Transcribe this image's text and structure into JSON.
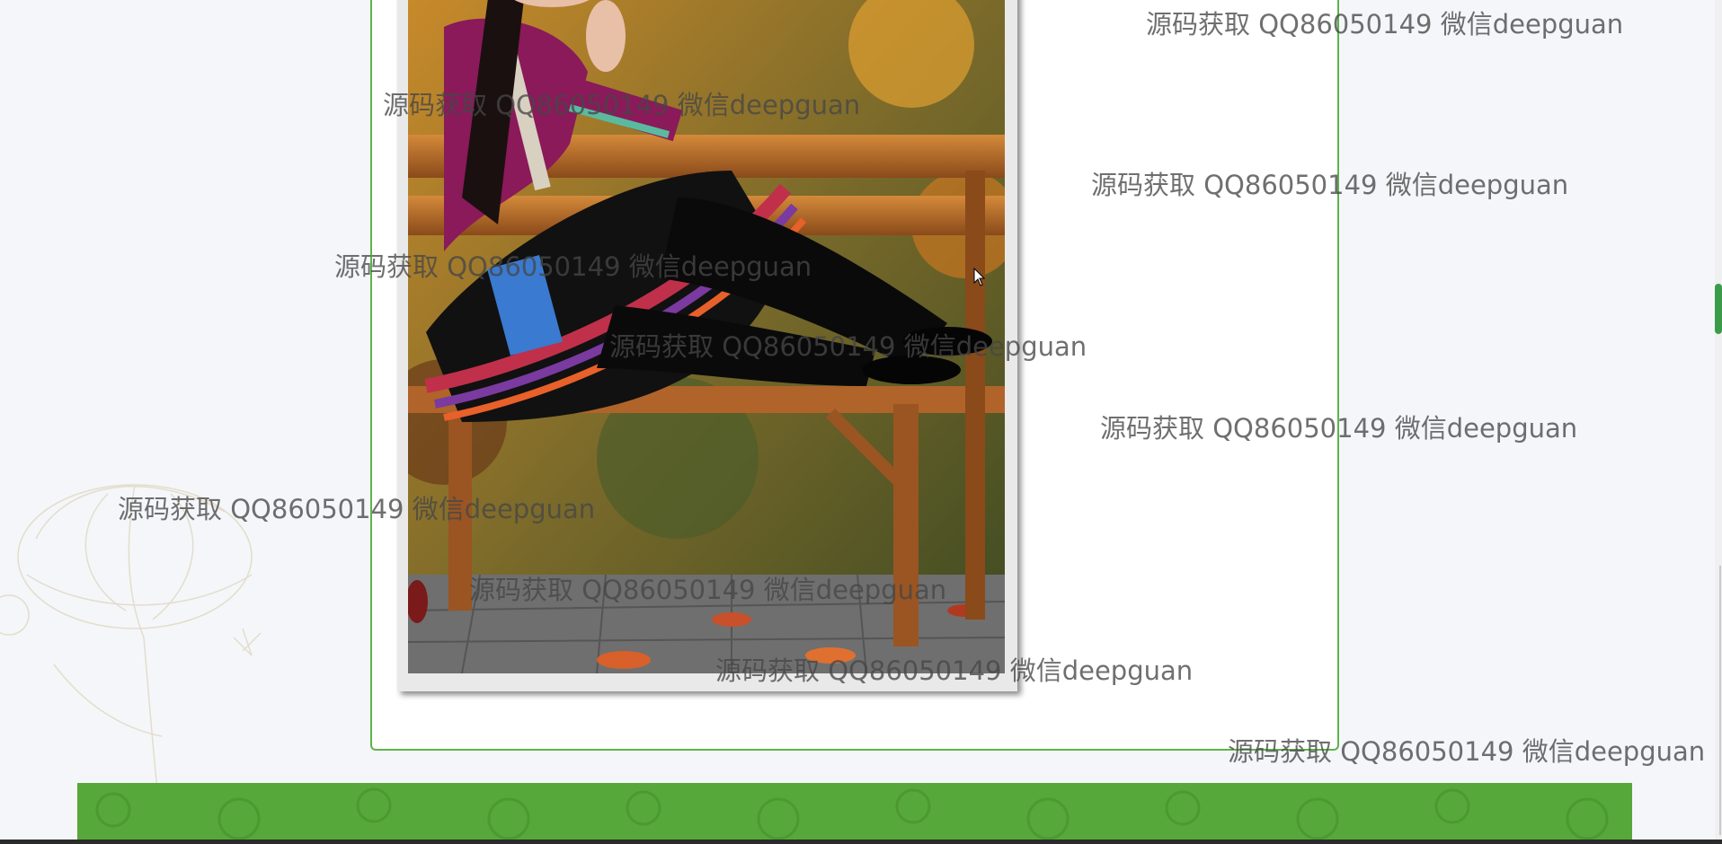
{
  "watermark": {
    "text": "源码获取 QQ86050149 微信deepguan"
  },
  "colors": {
    "frame_border": "#5db44a",
    "footer_band": "#56a83a",
    "scroll_thumb": "#3a9b4a",
    "background": "#f5f6fa"
  },
  "icons": {
    "cursor": "mouse-pointer-icon",
    "decoration": "lotus-line-art-icon"
  }
}
